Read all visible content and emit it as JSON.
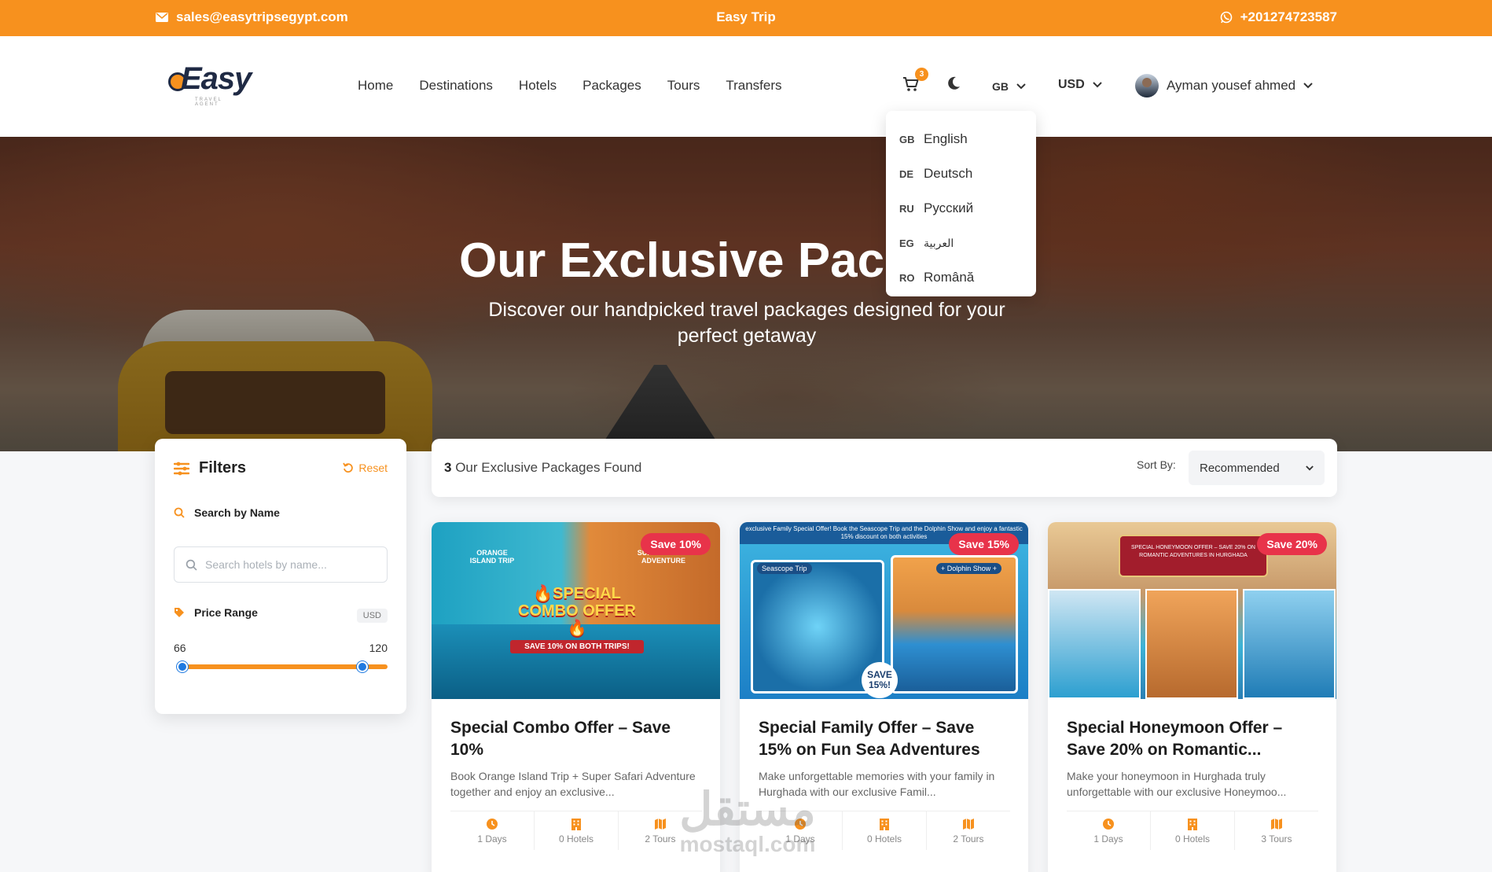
{
  "topbar": {
    "email": "sales@easytripsegypt.com",
    "brand": "Easy Trip",
    "phone": "+201274723587"
  },
  "logo": {
    "text": "Easy",
    "tagline": "TRAVEL AGENT"
  },
  "nav": {
    "items": [
      "Home",
      "Destinations",
      "Hotels",
      "Packages",
      "Tours",
      "Transfers"
    ]
  },
  "cart": {
    "count": "3"
  },
  "language": {
    "current": "GB"
  },
  "currency": {
    "current": "USD"
  },
  "user": {
    "name": "Ayman yousef ahmed"
  },
  "lang_menu": {
    "options": [
      {
        "code": "GB",
        "name": "English"
      },
      {
        "code": "DE",
        "name": "Deutsch"
      },
      {
        "code": "RU",
        "name": "Русский"
      },
      {
        "code": "EG",
        "name": "العربية"
      },
      {
        "code": "RO",
        "name": "Română"
      }
    ]
  },
  "hero": {
    "title": "Our Exclusive Pac",
    "subtitle": "Discover our handpicked travel packages designed for your perfect getaway"
  },
  "filters": {
    "title": "Filters",
    "reset": "Reset",
    "search_label": "Search by Name",
    "search_placeholder": "Search hotels by name...",
    "price_label": "Price Range",
    "price_currency": "USD",
    "price_min": "66",
    "price_max": "120",
    "slider_min_fraction": 0.0,
    "slider_max_fraction": 0.9
  },
  "results": {
    "count": "3",
    "label": "Our Exclusive Packages Found",
    "sort_label": "Sort By:",
    "sort_value": "Recommended"
  },
  "cards": [
    {
      "badge": "Save 10%",
      "title": "Special Combo Offer – Save 10%",
      "desc": "Book Orange Island Trip + Super Safari Adventure together and enjoy an exclusive...",
      "days": "1 Days",
      "hotels": "0 Hotels",
      "tours": "2 Tours",
      "img_left": "ORANGE ISLAND TRIP",
      "img_right": "SUPER SAFARI ADVENTURE",
      "img_big": "🔥SPECIAL COMBO OFFER🔥",
      "img_small": "SAVE 10% ON BOTH TRIPS!"
    },
    {
      "badge": "Save 15%",
      "title": "Special Family Offer – Save 15% on Fun Sea Adventures",
      "desc": "Make unforgettable memories with your family in Hurghada with our exclusive Famil...",
      "days": "1 Days",
      "hotels": "0 Hotels",
      "tours": "2 Tours",
      "img_top": "exclusive Family Special Offer! Book the Seascope Trip and the Dolphin Show and enjoy a fantastic 15% discount on both activities",
      "img_tag_left": "Seascope Trip",
      "img_tag_right": "+ Dolphin Show +",
      "img_seal": "SAVE 15%!"
    },
    {
      "badge": "Save 20%",
      "title": "Special Honeymoon Offer – Save 20% on Romantic...",
      "desc": "Make your honeymoon in Hurghada truly unforgettable with our exclusive Honeymoo...",
      "days": "1 Days",
      "hotels": "0 Hotels",
      "tours": "3 Tours",
      "img_banner": "SPECIAL HONEYMOON OFFER – SAVE 20% ON ROMANTIC ADVENTURES IN HURGHADA"
    }
  ],
  "watermark": {
    "arabic": "مستقل",
    "latin": "mostaql.com"
  },
  "colors": {
    "accent": "#f7911e",
    "badge": "#e8334a",
    "slider_thumb": "#1f7ae0"
  }
}
